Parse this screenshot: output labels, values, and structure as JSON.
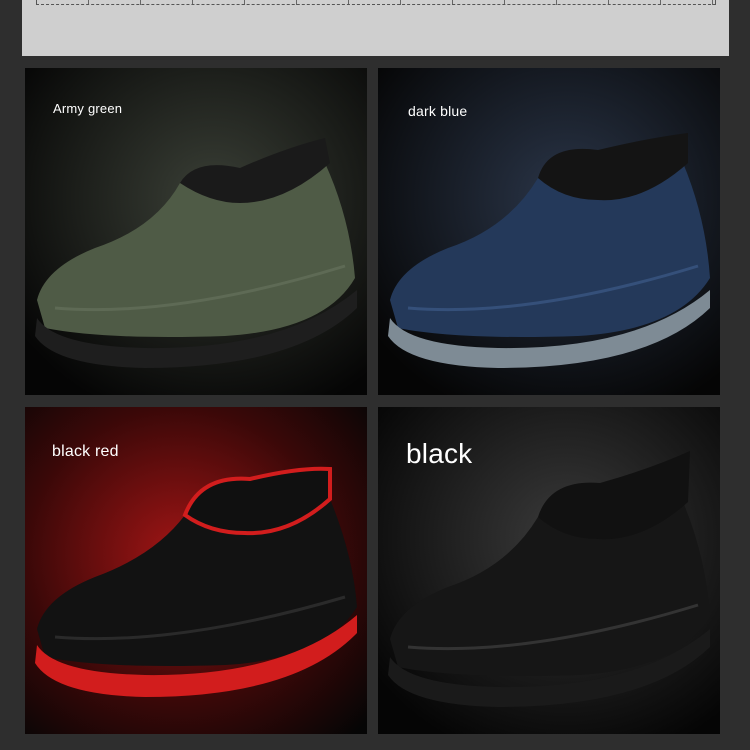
{
  "colors": {
    "page_background": "#2e2e2e",
    "top_panel": "#cfcfcf",
    "army_green": "#4e5a45",
    "dark_blue": "#243a57",
    "black_red_accent": "#d8201f",
    "black": "#151515"
  },
  "variants": [
    {
      "label": "Army green",
      "upper": "#4f5b46",
      "sole": "#1e1e1e",
      "collar": "#161616",
      "glow": "#3a3f36"
    },
    {
      "label": "dark blue",
      "upper": "#24395a",
      "sole": "#7e8b95",
      "collar": "#141414",
      "glow": "#2a3548"
    },
    {
      "label": "black red",
      "upper": "#121212",
      "sole": "#d21d1d",
      "collar": "#101010",
      "glow": "#a01515"
    },
    {
      "label": "black",
      "upper": "#161616",
      "sole": "#1a1a1a",
      "collar": "#111111",
      "glow": "#3a3a3a"
    }
  ]
}
